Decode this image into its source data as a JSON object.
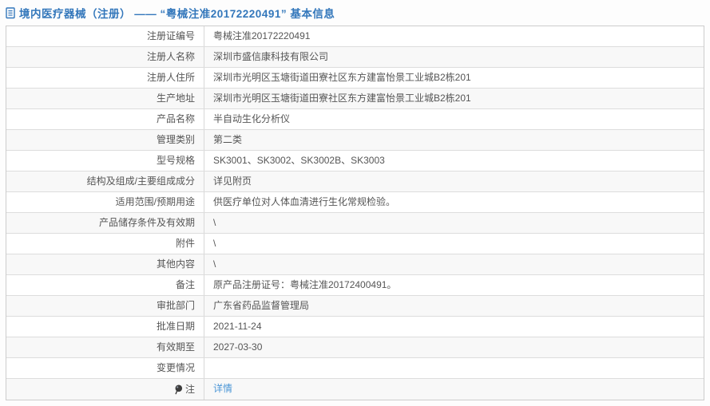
{
  "header": {
    "icon": "document-icon",
    "title": "境内医疗器械（注册） —— “粤械注准20172220491” 基本信息"
  },
  "colors": {
    "title_blue": "#3377bb",
    "link_blue": "#4b96d6",
    "row_stripe": "#f8f8f8",
    "text_gray": "#555555"
  },
  "table": {
    "rows": [
      {
        "label": "注册证编号",
        "value": "粤械注准20172220491"
      },
      {
        "label": "注册人名称",
        "value": "深圳市盛信康科技有限公司"
      },
      {
        "label": "注册人住所",
        "value": "深圳市光明区玉塘街道田寮社区东方建富怡景工业城B2栋201"
      },
      {
        "label": "生产地址",
        "value": "深圳市光明区玉塘街道田寮社区东方建富怡景工业城B2栋201"
      },
      {
        "label": "产品名称",
        "value": "半自动生化分析仪"
      },
      {
        "label": "管理类别",
        "value": "第二类"
      },
      {
        "label": "型号规格",
        "value": "SK3001、SK3002、SK3002B、SK3003"
      },
      {
        "label": "结构及组成/主要组成成分",
        "value": "详见附页"
      },
      {
        "label": "适用范围/预期用途",
        "value": "供医疗单位对人体血清进行生化常规检验。"
      },
      {
        "label": "产品储存条件及有效期",
        "value": "\\"
      },
      {
        "label": "附件",
        "value": "\\"
      },
      {
        "label": "其他内容",
        "value": "\\"
      },
      {
        "label": "备注",
        "value": "原产品注册证号：粤械注准20172400491。"
      },
      {
        "label": "审批部门",
        "value": "广东省药品监督管理局"
      },
      {
        "label": "批准日期",
        "value": "2021-11-24"
      },
      {
        "label": "有效期至",
        "value": "2027-03-30"
      },
      {
        "label": "变更情况",
        "value": ""
      },
      {
        "label": "注",
        "label_icon": "bulb-icon",
        "value": "详情",
        "is_link": true
      }
    ]
  }
}
